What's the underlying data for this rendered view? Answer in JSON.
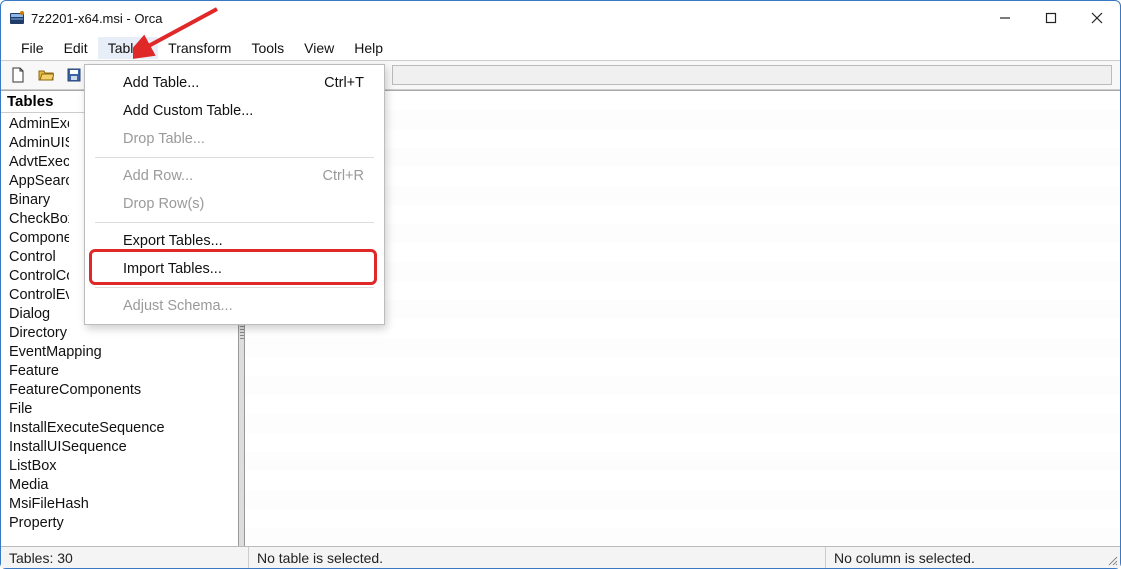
{
  "title": "7z2201-x64.msi - Orca",
  "menubar": [
    "File",
    "Edit",
    "Tables",
    "Transform",
    "Tools",
    "View",
    "Help"
  ],
  "active_menu_index": 2,
  "dropdown": {
    "items": [
      {
        "label": "Add Table...",
        "shortcut": "Ctrl+T",
        "enabled": true
      },
      {
        "label": "Add Custom Table...",
        "shortcut": "",
        "enabled": true
      },
      {
        "label": "Drop Table...",
        "shortcut": "",
        "enabled": false
      },
      {
        "sep": true
      },
      {
        "label": "Add Row...",
        "shortcut": "Ctrl+R",
        "enabled": false
      },
      {
        "label": "Drop Row(s)",
        "shortcut": "",
        "enabled": false
      },
      {
        "sep": true
      },
      {
        "label": "Export Tables...",
        "shortcut": "",
        "enabled": true
      },
      {
        "label": "Import Tables...",
        "shortcut": "",
        "enabled": true
      },
      {
        "sep": true
      },
      {
        "label": "Adjust Schema...",
        "shortcut": "",
        "enabled": false
      }
    ]
  },
  "tables_header": "Tables",
  "tables": [
    "AdminExecuteSequence",
    "AdminUISequence",
    "AdvtExecuteSequence",
    "AppSearch",
    "Binary",
    "CheckBox",
    "Component",
    "Control",
    "ControlCondition",
    "ControlEvent",
    "Dialog",
    "Directory",
    "EventMapping",
    "Feature",
    "FeatureComponents",
    "File",
    "InstallExecuteSequence",
    "InstallUISequence",
    "ListBox",
    "Media",
    "MsiFileHash",
    "Property"
  ],
  "status": {
    "left": "Tables: 30",
    "mid": "No table is selected.",
    "right": "No column is selected."
  }
}
